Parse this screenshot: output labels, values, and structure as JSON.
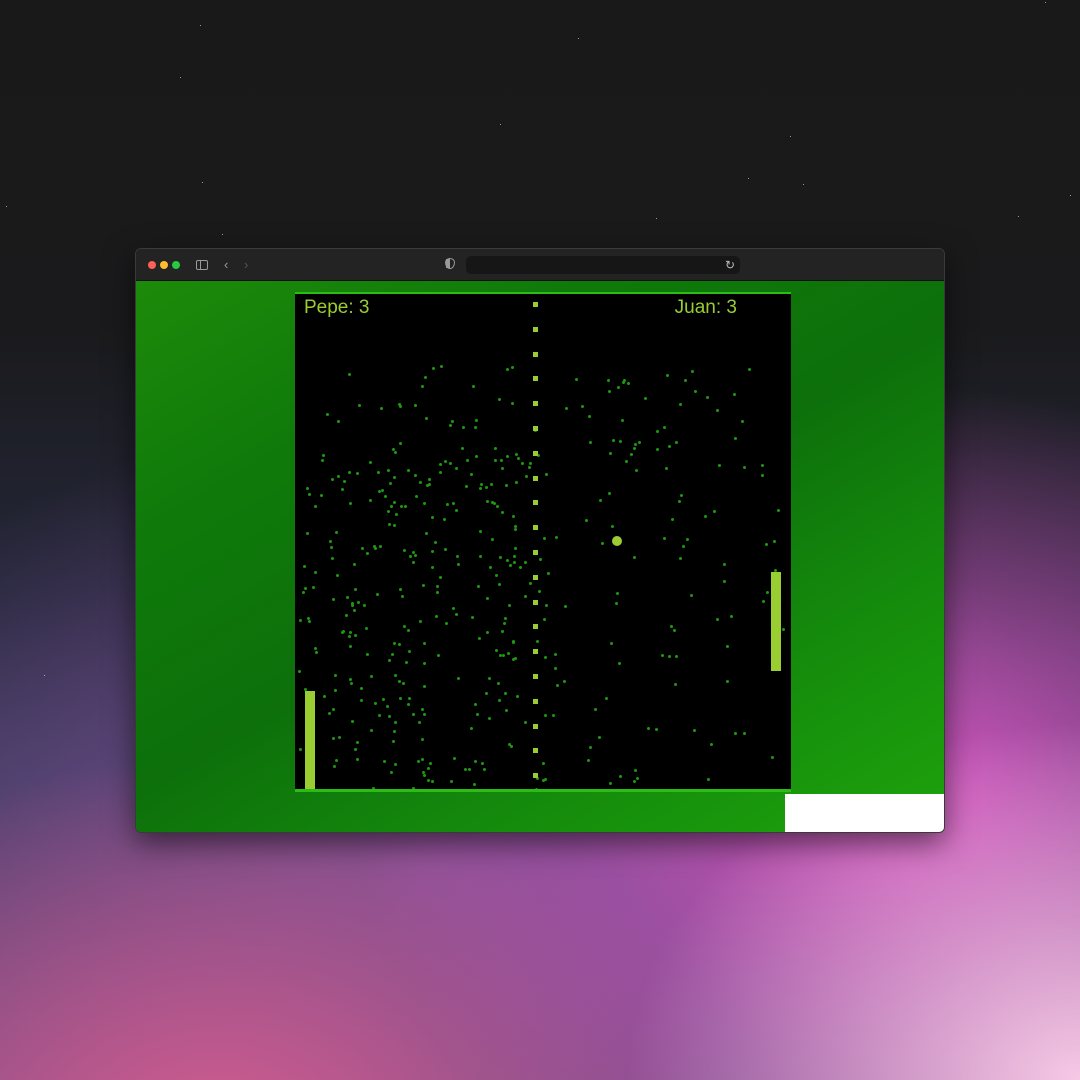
{
  "browser": {
    "address": "",
    "icons": {
      "sidebar": "sidebar-toggle-icon",
      "back": "chevron-left-icon",
      "forward": "chevron-right-icon",
      "security": "shield-icon",
      "reload": "reload-icon"
    }
  },
  "game": {
    "player_left": {
      "label": "Pepe: 3"
    },
    "player_right": {
      "label": "Juan: 3"
    },
    "colors": {
      "accent": "#9acd32",
      "court": "#000000",
      "page_background": "#0f7a0a",
      "border": "#2bbd16",
      "particles": "#1b9a10"
    }
  }
}
